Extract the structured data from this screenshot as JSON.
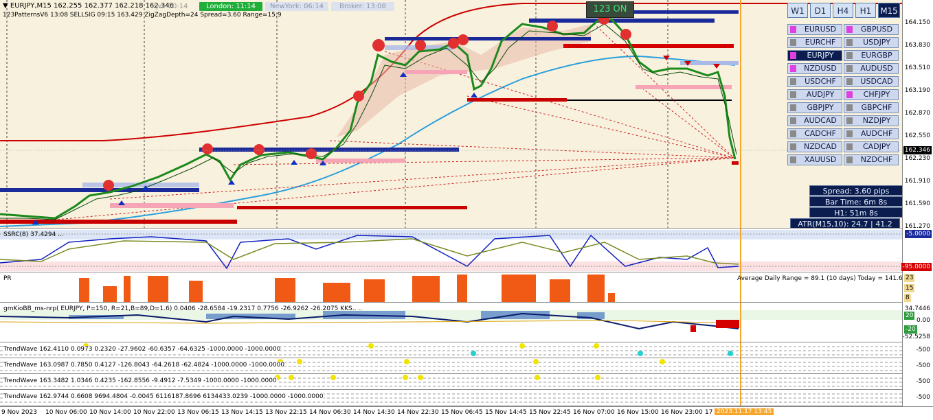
{
  "title_line": "EURJPY,M15  162.255 162.377 162.218 162.346",
  "indicator_line": "123PatternsV6  13:08  SELLSIG  09:15  163.429  ZigZagDepth=24  Spread=3.60  Range=15.9",
  "sessions": [
    {
      "label": "kyo: 20:14",
      "bg": "#FFFFFF",
      "fg": "#999999"
    },
    {
      "label": "London: 11:14",
      "bg": "#1fae3a",
      "fg": "#FFFFFF"
    },
    {
      "label": "NewYork: 06:14",
      "bg": "#dde3ee",
      "fg": "#8a93a8"
    },
    {
      "label": "Broker: 13:08",
      "bg": "#dde3ee",
      "fg": "#8a93a8"
    }
  ],
  "badge_123": "123 ON",
  "timeframes": [
    "W1",
    "D1",
    "H4",
    "H1",
    "M15"
  ],
  "active_timeframe": "M15",
  "pairs": [
    {
      "name": "EURUSD",
      "color": "#e040e0"
    },
    {
      "name": "GBPUSD",
      "color": "#e040e0"
    },
    {
      "name": "EURCHF",
      "color": "#8a8a8a"
    },
    {
      "name": "USDJPY",
      "color": "#8a8a8a"
    },
    {
      "name": "EURJPY",
      "color": "#e040e0"
    },
    {
      "name": "EURGBP",
      "color": "#8a8a8a"
    },
    {
      "name": "NZDUSD",
      "color": "#e040e0"
    },
    {
      "name": "AUDUSD",
      "color": "#8a8a8a"
    },
    {
      "name": "USDCHF",
      "color": "#8a8a8a"
    },
    {
      "name": "USDCAD",
      "color": "#8a8a8a"
    },
    {
      "name": "AUDJPY",
      "color": "#8a8a8a"
    },
    {
      "name": "CHFJPY",
      "color": "#e040e0"
    },
    {
      "name": "GBPJPY",
      "color": "#8a8a8a"
    },
    {
      "name": "GBPCHF",
      "color": "#8a8a8a"
    },
    {
      "name": "AUDCAD",
      "color": "#8a8a8a"
    },
    {
      "name": "NZDJPY",
      "color": "#8a8a8a"
    },
    {
      "name": "CADCHF",
      "color": "#8a8a8a"
    },
    {
      "name": "AUDCHF",
      "color": "#8a8a8a"
    },
    {
      "name": "NZDCAD",
      "color": "#8a8a8a"
    },
    {
      "name": "CADJPY",
      "color": "#8a8a8a"
    },
    {
      "name": "XAUUSD",
      "color": "#8a8a8a"
    },
    {
      "name": "NZDCHF",
      "color": "#8a8a8a"
    }
  ],
  "active_pair": "EURJPY",
  "info": {
    "spread": "Spread: 3.60 pips",
    "bar_time": "Bar Time: 6m 8s",
    "h1": "H1: 51m 8s",
    "atr": "ATR(M15,10): 24.7  |  41.2 pips"
  },
  "price_axis": [
    "164.150",
    "163.830",
    "163.510",
    "163.190",
    "162.870",
    "162.550",
    "162.346",
    "162.230",
    "161.910",
    "161.590",
    "161.270"
  ],
  "current_price": "162.346",
  "rsi_label": "SSRC(8) 37.4294 ...",
  "rsi_axis": [
    "-5.0000",
    "-95.0000"
  ],
  "pr_label": "PR",
  "pr_right": "Average Daily Range = 89.1 (10 days)    Today = 141.6",
  "pr_axis": [
    "23",
    "15",
    "8"
  ],
  "kio_label": "gmKioBB_ms-nrp( EURJPY, P=150, R=21,B=89,D=1.6) 0.0406 -28.6584 -19.2317 0.7756 -26.9262 -26.2075  KKS.. ..",
  "kio_axis": [
    "34.7446",
    "20",
    "0.00",
    "-20",
    "-52.5258"
  ],
  "trendwaves": [
    "TrendWave 162.4110 0.0973 0.2320 -27.9602 -60.6357 -64.6325 -1000.0000 -1000.0000",
    "TrendWave 163.0987 0.7850 0.4127 -126.8043 -64.2618 -62.4824 -1000.0000 -1000.0000",
    "TrendWave 163.3482 1.0346 0.4235 -162.8556 -9.4912 -7.5349 -1000.0000 -1000.0000",
    "TrendWave 162.9744 0.6608 9694.4804 -0.0045 6116187.8696 6134433.0239 -1000.0000 -1000.0000"
  ],
  "tw_axis": "-500",
  "time_axis": [
    "9 Nov 2023",
    "10 Nov 06:00",
    "10 Nov 14:00",
    "10 Nov 22:00",
    "13 Nov 06:15",
    "13 Nov 14:15",
    "13 Nov 22:15",
    "14 Nov 06:30",
    "14 Nov 14:30",
    "14 Nov 22:30",
    "15 Nov 06:45",
    "15 Nov 14:45",
    "15 Nov 22:45",
    "16 Nov 07:00",
    "16 Nov 15:00",
    "16 Nov 23:00",
    "17",
    "2023.11.17 13:45"
  ],
  "colors": {
    "chart_bg": "#F8F1DD",
    "bull_line": "#1b8a1b",
    "red_band": "#cc0000",
    "blue_ma": "#2a9fdc",
    "level_blue": "#1020a0",
    "level_red": "#d40000",
    "histogram": "#f05a14",
    "vline": "#f7a62a"
  }
}
